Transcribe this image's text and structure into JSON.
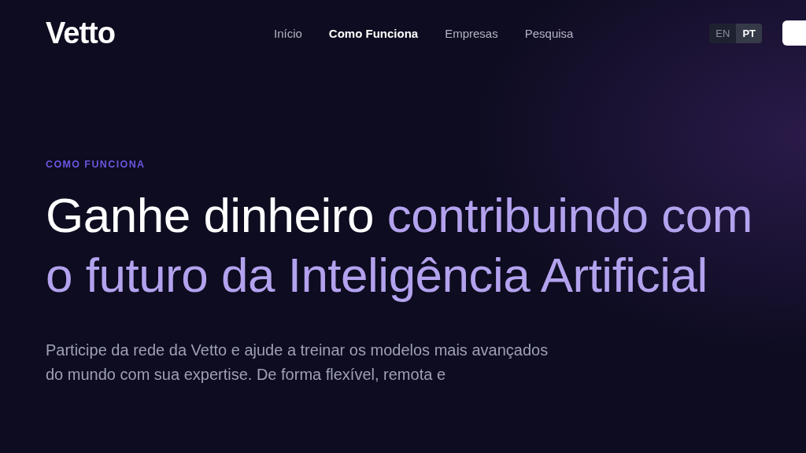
{
  "logo": "Vetto",
  "nav": [
    {
      "label": "Início",
      "selected": false
    },
    {
      "label": "Como Funciona",
      "selected": true
    },
    {
      "label": "Empresas",
      "selected": false
    },
    {
      "label": "Pesquisa",
      "selected": false
    }
  ],
  "languages": [
    {
      "label": "EN",
      "selected": false
    },
    {
      "label": "PT",
      "selected": true
    }
  ],
  "hero": {
    "eyebrow": "COMO FUNCIONA",
    "heading_plain": "Ganhe dinheiro",
    "heading_highlight": "contribuindo com o futuro da Inteligência Artificial",
    "text": "Participe da rede da Vetto e ajude a treinar os modelos mais avançados do mundo com sua expertise. De forma flexível, remota e"
  }
}
